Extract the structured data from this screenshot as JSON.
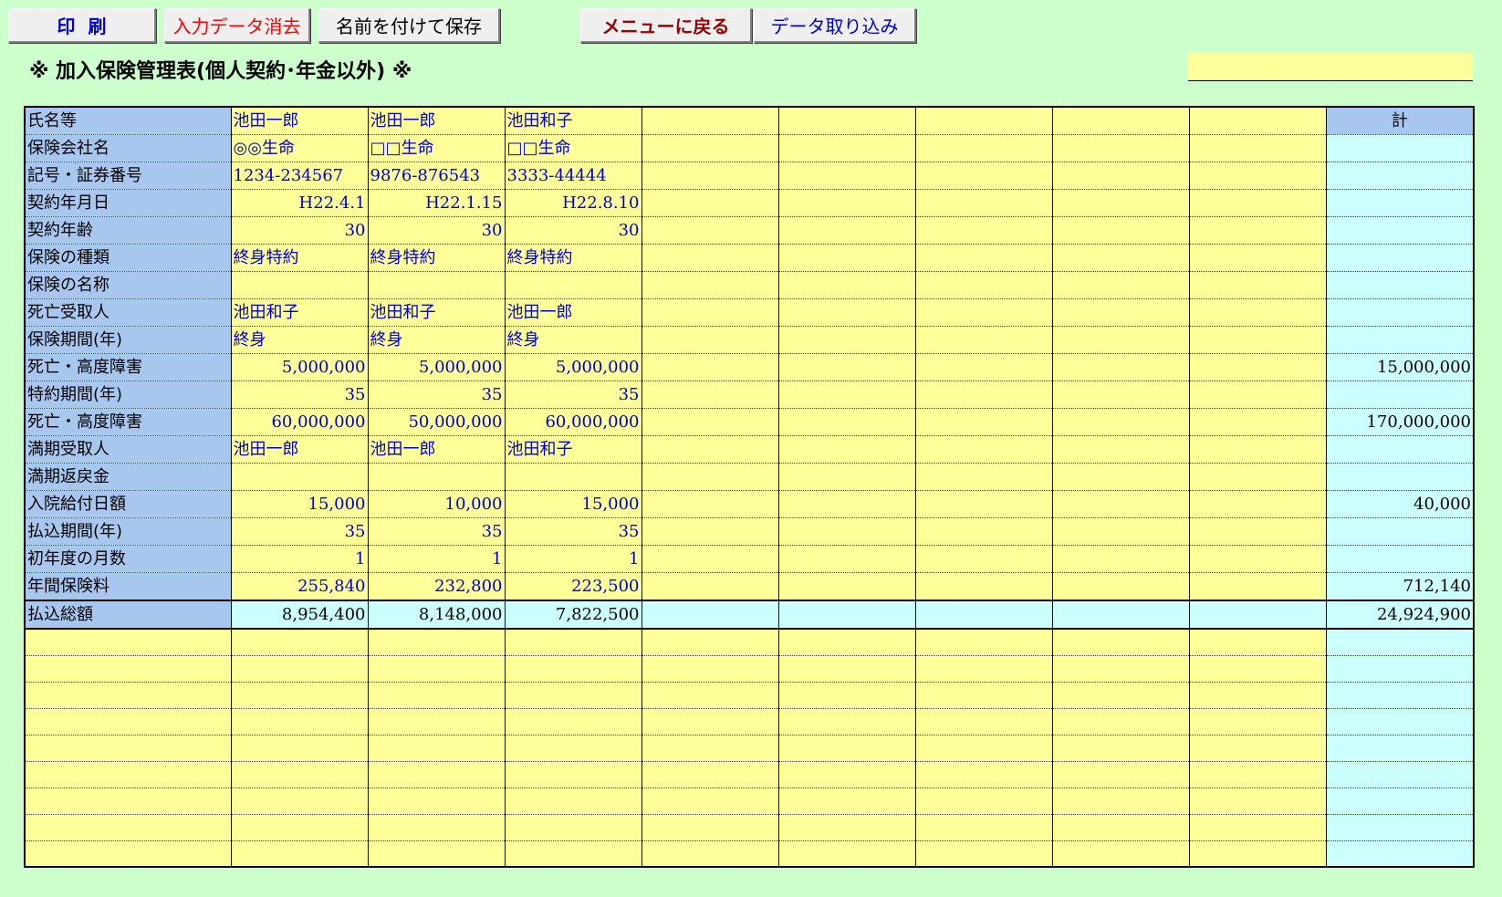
{
  "toolbar": {
    "print_label": "印刷",
    "clear_label": "入力データ消去",
    "saveas_label": "名前を付けて保存",
    "menu_label": "メニューに戻る",
    "import_label": "データ取り込み"
  },
  "title": "※ 加入保険管理表(個人契約･年金以外) ※",
  "sum_header": "計",
  "rows": [
    {
      "label": "氏名等",
      "values": [
        "池田一郎",
        "池田一郎",
        "池田和子",
        "",
        "",
        "",
        "",
        ""
      ],
      "total": "",
      "align": "left"
    },
    {
      "label": "保険会社名",
      "values": [
        "◎◎生命",
        "□□生命",
        "□□生命",
        "",
        "",
        "",
        "",
        ""
      ],
      "total": "",
      "align": "left"
    },
    {
      "label": "記号・証券番号",
      "values": [
        "1234-234567",
        "9876-876543",
        "3333-44444",
        "",
        "",
        "",
        "",
        ""
      ],
      "total": "",
      "align": "left"
    },
    {
      "label": "契約年月日",
      "values": [
        "H22.4.1",
        "H22.1.15",
        "H22.8.10",
        "",
        "",
        "",
        "",
        ""
      ],
      "total": "",
      "align": "right"
    },
    {
      "label": "契約年齢",
      "values": [
        "30",
        "30",
        "30",
        "",
        "",
        "",
        "",
        ""
      ],
      "total": "",
      "align": "right"
    },
    {
      "label": "保険の種類",
      "values": [
        "終身特約",
        "終身特約",
        "終身特約",
        "",
        "",
        "",
        "",
        ""
      ],
      "total": "",
      "align": "left"
    },
    {
      "label": "保険の名称",
      "values": [
        "",
        "",
        "",
        "",
        "",
        "",
        "",
        ""
      ],
      "total": "",
      "align": "left"
    },
    {
      "label": "死亡受取人",
      "values": [
        "池田和子",
        "池田和子",
        "池田一郎",
        "",
        "",
        "",
        "",
        ""
      ],
      "total": "",
      "align": "left"
    },
    {
      "label": "保険期間(年)",
      "values": [
        "終身",
        "終身",
        "終身",
        "",
        "",
        "",
        "",
        ""
      ],
      "total": "",
      "align": "left"
    },
    {
      "label": "死亡・高度障害",
      "values": [
        "5,000,000",
        "5,000,000",
        "5,000,000",
        "",
        "",
        "",
        "",
        ""
      ],
      "total": "15,000,000",
      "align": "right"
    },
    {
      "label": "特約期間(年)",
      "values": [
        "35",
        "35",
        "35",
        "",
        "",
        "",
        "",
        ""
      ],
      "total": "",
      "align": "right"
    },
    {
      "label": "死亡・高度障害",
      "values": [
        "60,000,000",
        "50,000,000",
        "60,000,000",
        "",
        "",
        "",
        "",
        ""
      ],
      "total": "170,000,000",
      "align": "right"
    },
    {
      "label": "満期受取人",
      "values": [
        "池田一郎",
        "池田一郎",
        "池田和子",
        "",
        "",
        "",
        "",
        ""
      ],
      "total": "",
      "align": "left"
    },
    {
      "label": "満期返戻金",
      "values": [
        "",
        "",
        "",
        "",
        "",
        "",
        "",
        ""
      ],
      "total": "",
      "align": "left"
    },
    {
      "label": "入院給付日額",
      "values": [
        "15,000",
        "10,000",
        "15,000",
        "",
        "",
        "",
        "",
        ""
      ],
      "total": "40,000",
      "align": "right"
    },
    {
      "label": "払込期間(年)",
      "values": [
        "35",
        "35",
        "35",
        "",
        "",
        "",
        "",
        ""
      ],
      "total": "",
      "align": "right"
    },
    {
      "label": "初年度の月数",
      "values": [
        "1",
        "1",
        "1",
        "",
        "",
        "",
        "",
        ""
      ],
      "total": "",
      "align": "right"
    },
    {
      "label": "年間保険料",
      "values": [
        "255,840",
        "232,800",
        "223,500",
        "",
        "",
        "",
        "",
        ""
      ],
      "total": "712,140",
      "align": "right"
    }
  ],
  "total_row": {
    "label": "払込総額",
    "values": [
      "8,954,400",
      "8,148,000",
      "7,822,500",
      "",
      "",
      "",
      "",
      ""
    ],
    "total": "24,924,900"
  },
  "blank_row_count": 9
}
